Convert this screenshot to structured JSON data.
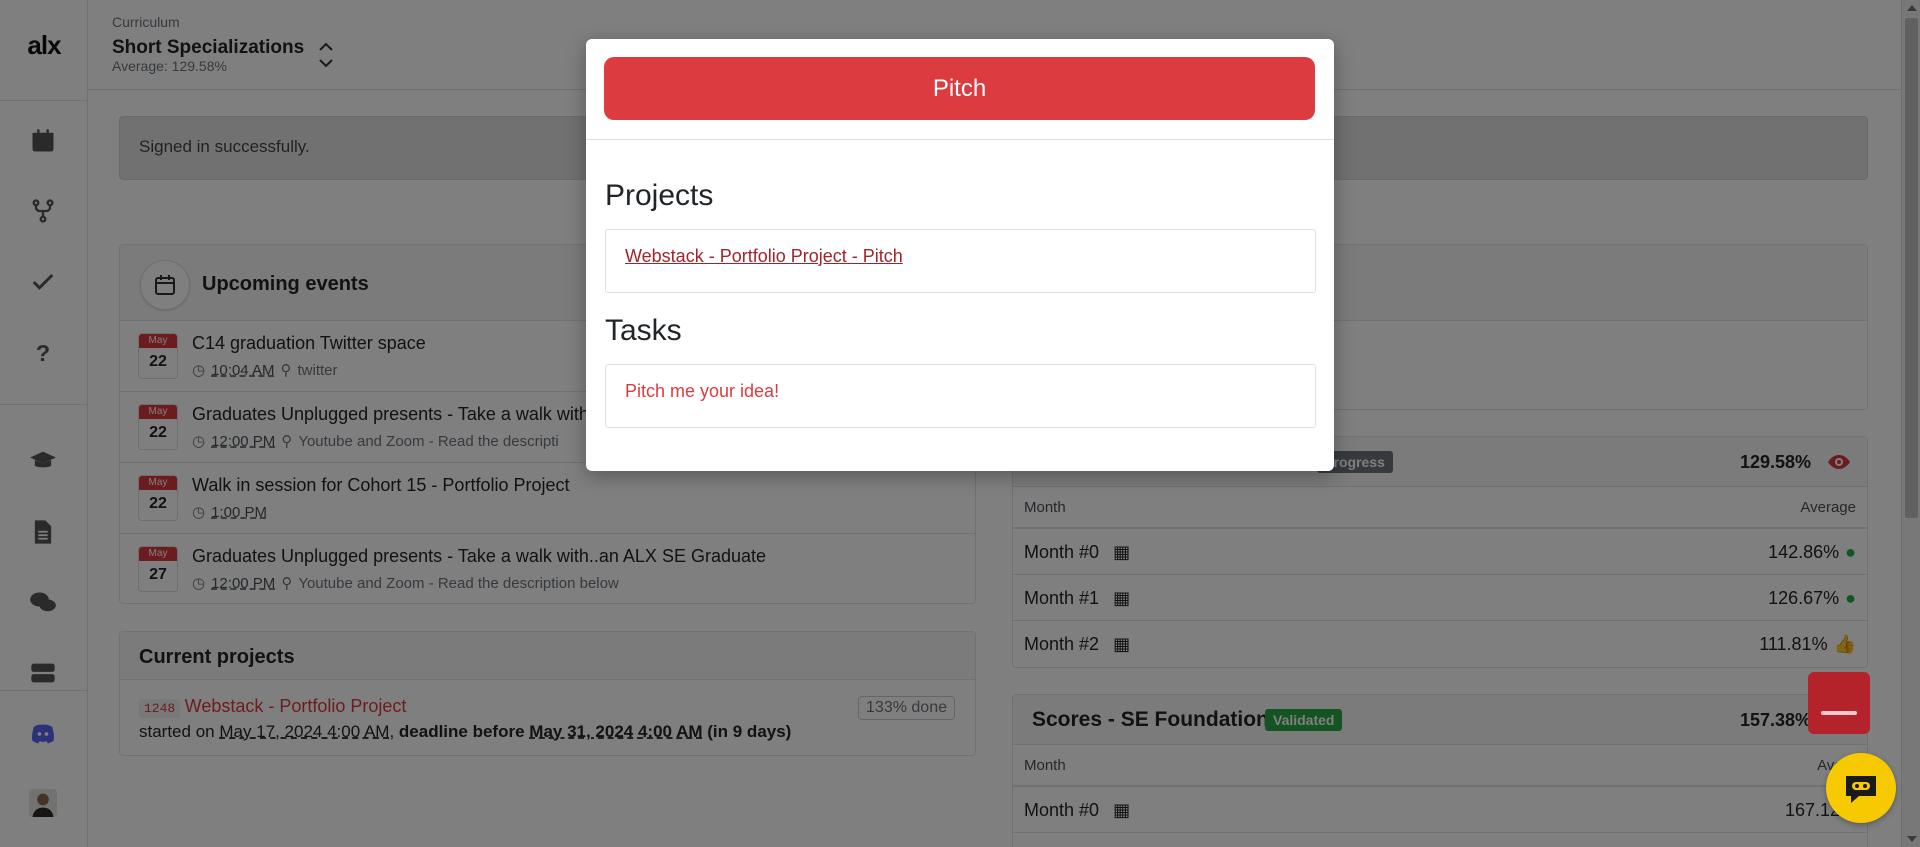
{
  "app": {
    "logo_text": "alx"
  },
  "header": {
    "label": "Curriculum",
    "title": "Short Specializations",
    "average": "Average: 129.58%"
  },
  "sidebar": {
    "items": [
      {
        "icon": "calendar-icon"
      },
      {
        "icon": "fork-icon"
      },
      {
        "icon": "check-icon"
      },
      {
        "icon": "question-icon"
      },
      {
        "icon": "graduation-cap-icon"
      },
      {
        "icon": "document-icon"
      },
      {
        "icon": "chat-icon"
      },
      {
        "icon": "server-icon"
      },
      {
        "icon": "discord-icon"
      },
      {
        "icon": "avatar"
      }
    ]
  },
  "alert": {
    "text": "Signed in successfully."
  },
  "events": {
    "title": "Upcoming events",
    "items": [
      {
        "month": "May",
        "day": "22",
        "title": "C14 graduation Twitter space",
        "time": "10:04 AM",
        "location": "twitter"
      },
      {
        "month": "May",
        "day": "22",
        "title": "Graduates Unplugged presents - Take a walk with",
        "time": "12:00 PM",
        "location": "Youtube and Zoom - Read the descripti"
      },
      {
        "month": "May",
        "day": "22",
        "title": "Walk in session for Cohort 15 - Portfolio Project",
        "time": "1:00 PM",
        "location": ""
      },
      {
        "month": "May",
        "day": "27",
        "title": "Graduates Unplugged presents - Take a walk with..an ALX SE Graduate",
        "time": "12:00 PM",
        "location": "Youtube and Zoom - Read the description below"
      }
    ]
  },
  "current_projects": {
    "title": "Current projects",
    "id": "1248",
    "name": "Webstack - Portfolio Project",
    "progress": "133% done",
    "started_prefix": "started on",
    "started": "May 17, 2024 4:00 AM",
    "deadline_prefix": "deadline before",
    "deadline": "May 31, 2024 4:00 AM",
    "remaining": "(in 9 days)"
  },
  "scores_current": {
    "badge": "progress",
    "percent": "129.58%",
    "col_month": "Month",
    "col_average": "Average",
    "rows": [
      {
        "month": "Month #0",
        "average": "142.86%",
        "status": "check"
      },
      {
        "month": "Month #1",
        "average": "126.67%",
        "status": "check"
      },
      {
        "month": "Month #2",
        "average": "111.81%",
        "status": "thumbs-up"
      }
    ]
  },
  "scores_foundations": {
    "title": "Scores - SE Foundations",
    "badge": "Validated",
    "percent": "157.38%",
    "col_month": "Month",
    "col_average": "Avera",
    "rows": [
      {
        "month": "Month #0",
        "average": "167.12%"
      }
    ]
  },
  "modal": {
    "button": "Pitch",
    "projects_title": "Projects",
    "project_link": "Webstack - Portfolio Project - Pitch",
    "tasks_title": "Tasks",
    "task": "Pitch me your idea!"
  },
  "colors": {
    "brand_red": "#dc3b3f",
    "success": "#28a745",
    "progress_badge": "#6c757d",
    "chat_yellow": "#f7c900"
  }
}
